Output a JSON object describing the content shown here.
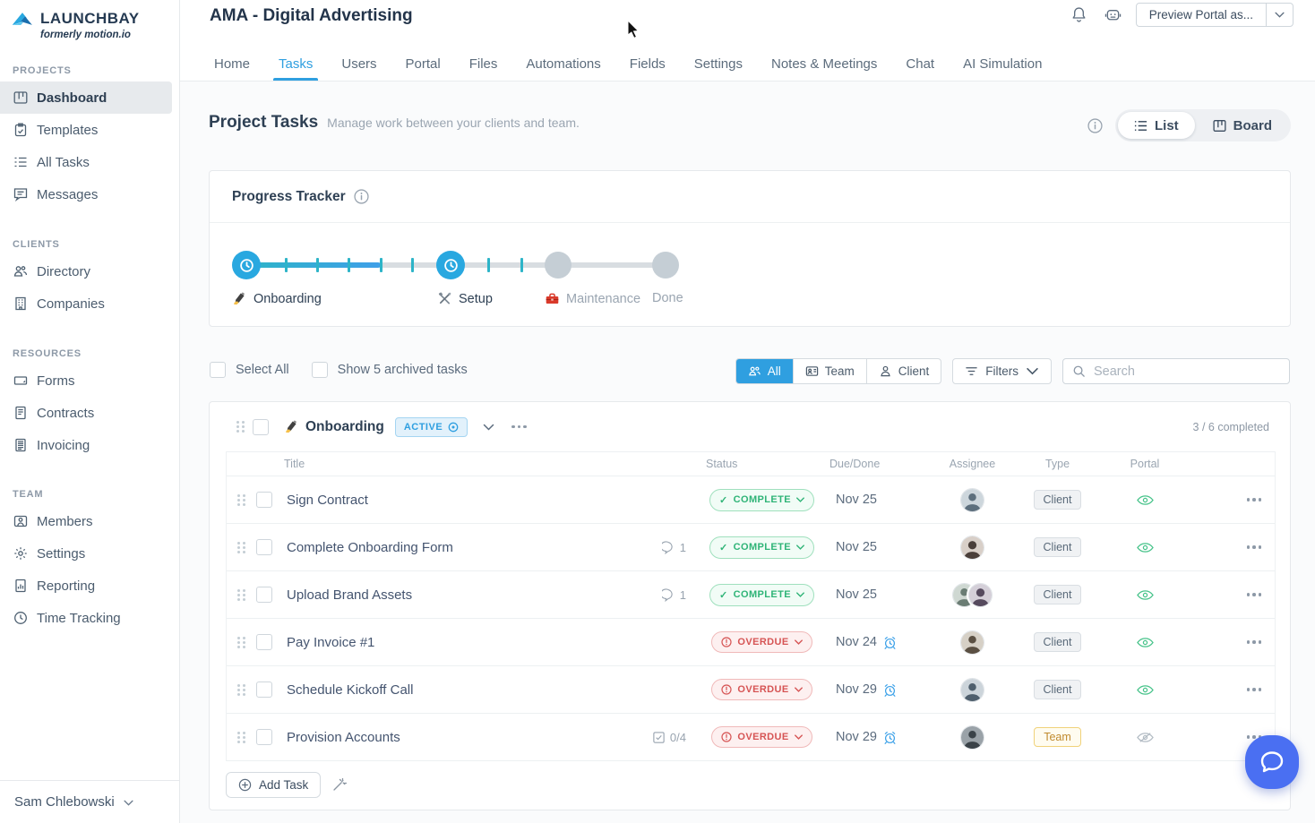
{
  "brand": {
    "name": "LAUNCHBAY",
    "tagline": "formerly motion.io"
  },
  "sidebar": {
    "sections": [
      {
        "label": "PROJECTS",
        "items": [
          "Dashboard",
          "Templates",
          "All Tasks",
          "Messages"
        ]
      },
      {
        "label": "CLIENTS",
        "items": [
          "Directory",
          "Companies"
        ]
      },
      {
        "label": "RESOURCES",
        "items": [
          "Forms",
          "Contracts",
          "Invoicing"
        ]
      },
      {
        "label": "TEAM",
        "items": [
          "Members",
          "Settings",
          "Reporting",
          "Time Tracking"
        ]
      }
    ],
    "user": "Sam Chlebowski"
  },
  "header": {
    "title": "AMA - Digital Advertising",
    "preview_button": "Preview Portal as...",
    "tabs": [
      "Home",
      "Tasks",
      "Users",
      "Portal",
      "Files",
      "Automations",
      "Fields",
      "Settings",
      "Notes & Meetings",
      "Chat",
      "AI Simulation"
    ],
    "active_tab": "Tasks"
  },
  "page": {
    "title": "Project Tasks",
    "subtitle": "Manage work between your clients and team.",
    "list_label": "List",
    "board_label": "Board"
  },
  "progress_tracker": {
    "title": "Progress Tracker",
    "stages": [
      {
        "label": "Onboarding",
        "icon": "writing-hand-icon",
        "state": "current"
      },
      {
        "label": "Setup",
        "icon": "hammer-wrench-icon",
        "state": "current"
      },
      {
        "label": "Maintenance",
        "icon": "toolbox-icon",
        "state": "upcoming"
      },
      {
        "label": "Done",
        "icon": "",
        "state": "upcoming"
      }
    ]
  },
  "toolbar": {
    "select_all": "Select All",
    "show_archived": "Show 5 archived tasks",
    "segments": {
      "all": "All",
      "team": "Team",
      "client": "Client",
      "active": "All"
    },
    "filters": "Filters",
    "search_placeholder": "Search"
  },
  "task_group": {
    "name": "Onboarding",
    "badge": "ACTIVE",
    "progress": "3 / 6 completed",
    "columns": {
      "title": "Title",
      "status": "Status",
      "due": "Due/Done",
      "assignee": "Assignee",
      "type": "Type",
      "portal": "Portal"
    },
    "tasks": [
      {
        "title": "Sign Contract",
        "status": "COMPLETE",
        "due": "Nov 25",
        "type": "Client"
      },
      {
        "title": "Complete Onboarding Form",
        "comments": "1",
        "status": "COMPLETE",
        "due": "Nov 25",
        "type": "Client"
      },
      {
        "title": "Upload Brand Assets",
        "comments": "1",
        "status": "COMPLETE",
        "due": "Nov 25",
        "type": "Client"
      },
      {
        "title": "Pay Invoice #1",
        "status": "OVERDUE",
        "due": "Nov 24",
        "type": "Client"
      },
      {
        "title": "Schedule Kickoff Call",
        "status": "OVERDUE",
        "due": "Nov 29",
        "type": "Client"
      },
      {
        "title": "Provision Accounts",
        "subtasks": "0/4",
        "status": "OVERDUE",
        "due": "Nov 29",
        "type": "Team"
      }
    ],
    "add_task": "Add Task"
  },
  "colors": {
    "accent_blue": "#2f9fe0",
    "teal": "#2db4c8",
    "success": "#2fb477",
    "danger": "#d65454",
    "team_badge": "#c08a2e",
    "chat_fab": "#4a6ff2"
  }
}
